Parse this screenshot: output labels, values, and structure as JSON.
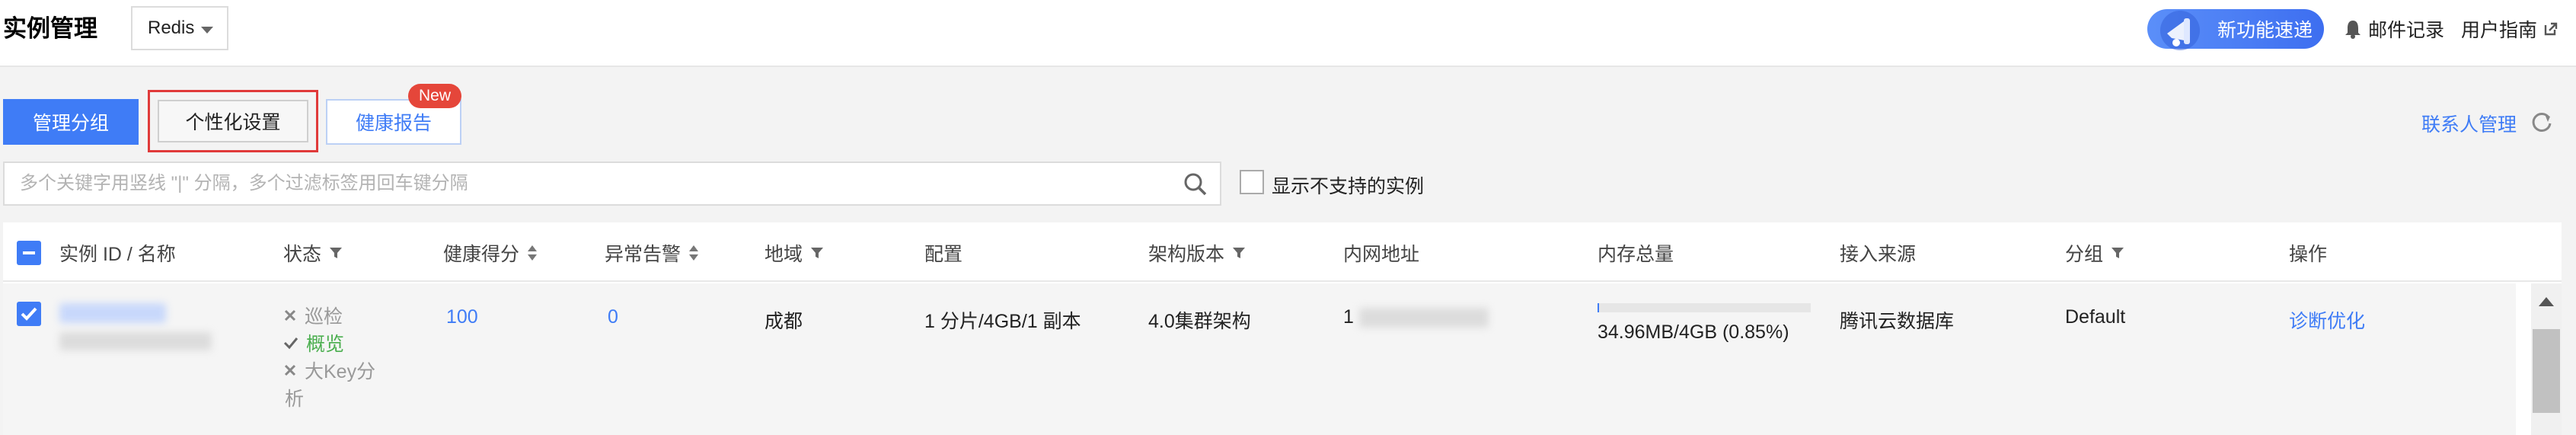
{
  "header": {
    "title": "实例管理",
    "product": "Redis",
    "new_feature": "新功能速递",
    "mail_record": "邮件记录",
    "user_guide": "用户指南"
  },
  "tabs": [
    {
      "label": "管理分组"
    },
    {
      "label": "个性化设置"
    },
    {
      "label": "健康报告"
    }
  ],
  "new_badge": "New",
  "contact_link": "联系人管理",
  "search": {
    "placeholder": "多个关键字用竖线 \"|\" 分隔，多个过滤标签用回车键分隔",
    "value": ""
  },
  "show_unsupported_label": "显示不支持的实例",
  "columns": {
    "instance": "实例 ID / 名称",
    "status": "状态",
    "health": "健康得分",
    "alarm": "异常告警",
    "region": "地域",
    "config": "配置",
    "arch": "架构版本",
    "ip": "内网地址",
    "memory": "内存总量",
    "source": "接入来源",
    "group": "分组",
    "action": "操作"
  },
  "rows": [
    {
      "actions": [
        {
          "icon": "close-icon",
          "label": "巡检",
          "enabled": false
        },
        {
          "icon": "check-icon",
          "label": "概览",
          "enabled": true
        },
        {
          "icon": "close-icon",
          "label": "大Key分",
          "enabled": false
        }
      ],
      "action_wrap": "析",
      "health_score": "100",
      "alarm_count": "0",
      "region": "成都",
      "config": "1 分片/4GB/1 副本",
      "arch": "4.0集群架构",
      "ip_prefix": "1",
      "memory_text": "34.96MB/4GB (0.85%)",
      "memory_usage": 0.0085,
      "source": "腾讯云数据库",
      "group": "Default",
      "operation": "诊断优化"
    }
  ],
  "colors": {
    "primary": "#3f7cf6",
    "danger": "#e5463a",
    "success": "#4caf50"
  }
}
